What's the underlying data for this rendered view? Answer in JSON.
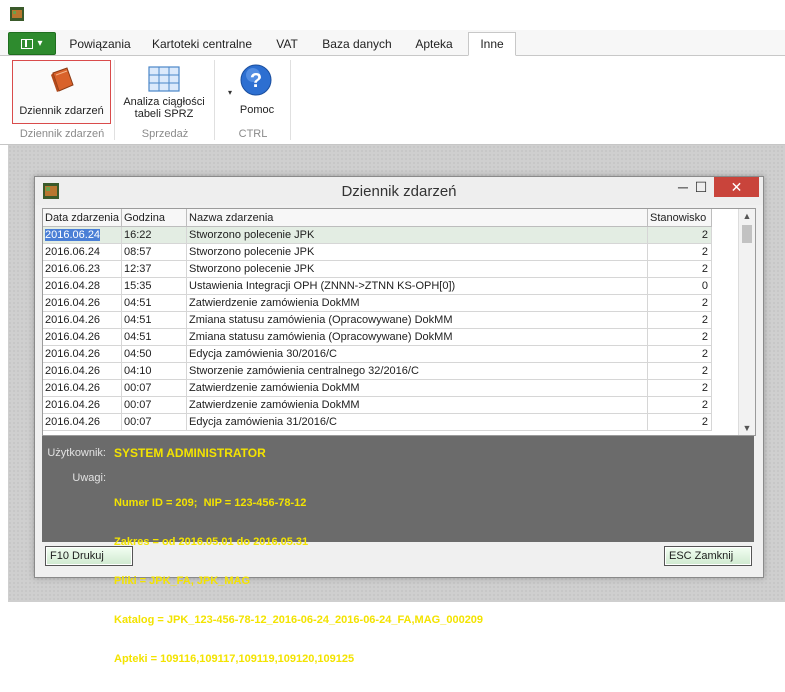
{
  "ribbon": {
    "tabs": [
      "Powiązania",
      "Kartoteki centralne",
      "VAT",
      "Baza danych",
      "Apteka",
      "Inne"
    ],
    "active_tab": "Inne",
    "buttons": {
      "dziennik": "Dziennik zdarzeń",
      "analiza_line1": "Analiza ciągłości",
      "analiza_line2": "tabeli SPRZ",
      "pomoc": "Pomoc"
    },
    "groups": {
      "dziennik": "Dziennik zdarzeń",
      "sprzedaz": "Sprzedaż",
      "ctrl": "CTRL"
    }
  },
  "dialog": {
    "title": "Dziennik zdarzeń",
    "controls": {
      "minimize": "─",
      "maximize": "☐",
      "close": "✕"
    },
    "columns": [
      "Data zdarzenia",
      "Godzina",
      "Nazwa zdarzenia",
      "Stanowisko"
    ],
    "rows": [
      [
        "2016.06.24",
        "16:22",
        "Stworzono polecenie JPK",
        "2"
      ],
      [
        "2016.06.24",
        "08:57",
        "Stworzono polecenie JPK",
        "2"
      ],
      [
        "2016.06.23",
        "12:37",
        "Stworzono polecenie JPK",
        "2"
      ],
      [
        "2016.04.28",
        "15:35",
        "Ustawienia Integracji OPH (ZNNN->ZTNN KS-OPH[0])",
        "0"
      ],
      [
        "2016.04.26",
        "04:51",
        "Zatwierdzenie zamówienia DokMM",
        "2"
      ],
      [
        "2016.04.26",
        "04:51",
        "Zmiana statusu zamówienia (Opracowywane) DokMM",
        "2"
      ],
      [
        "2016.04.26",
        "04:51",
        "Zmiana statusu zamówienia (Opracowywane) DokMM",
        "2"
      ],
      [
        "2016.04.26",
        "04:50",
        "Edycja zamówienia 30/2016/C",
        "2"
      ],
      [
        "2016.04.26",
        "04:10",
        "Stworzenie zamówienia centralnego 32/2016/C",
        "2"
      ],
      [
        "2016.04.26",
        "00:07",
        "Zatwierdzenie zamówienia DokMM",
        "2"
      ],
      [
        "2016.04.26",
        "00:07",
        "Zatwierdzenie zamówienia DokMM",
        "2"
      ],
      [
        "2016.04.26",
        "00:07",
        "Edycja zamówienia 31/2016/C",
        "2"
      ]
    ],
    "info": {
      "user_label": "Użytkownik:",
      "user_value": "SYSTEM ADMINISTRATOR",
      "notes_label": "Uwagi:",
      "notes": [
        "Numer ID = 209;  NIP = 123-456-78-12",
        "Zakres = od 2016.05.01 do 2016.05.31",
        "Pliki = JPK_FA, JPK_MAG",
        "Katalog = JPK_123-456-78-12_2016-06-24_2016-06-24_FA,MAG_000209",
        "Apteki = 109116,109117,109119,109120,109125"
      ]
    },
    "print_button": "F10 Drukuj",
    "close_button": "ESC Zamknij"
  }
}
